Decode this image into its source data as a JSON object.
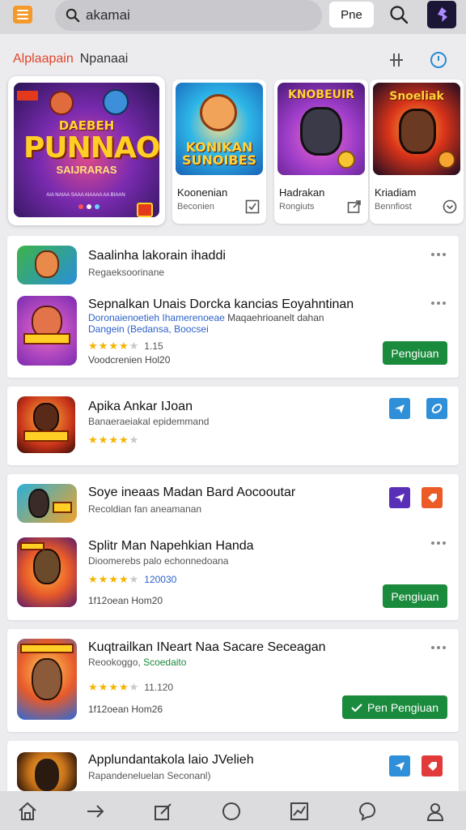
{
  "topbar": {
    "search_text": "akamai",
    "pne_label": "Pne",
    "menu_icon": "hamburger-menu-icon",
    "search_icon": "search-icon",
    "app_icon": "app-logo-icon"
  },
  "section": {
    "title_a": "Alplaapain",
    "title_b": "Npanaai"
  },
  "featured": {
    "main": {
      "line1": "DAEBEH",
      "line2": "PUNNAOK",
      "line3": "SAIJRARAS",
      "fine_print": "AIA NAIAA SAAA AIAAAA AA BIAAN"
    },
    "cards": [
      {
        "art_title": "KONIKAN SUNOIBES",
        "name": "Koonenian",
        "sub": "Beconien",
        "action_icon": "checkbox-icon"
      },
      {
        "art_title": "KNOBEUIR",
        "name": "Hadrakan",
        "sub": "Rongiuts",
        "action_icon": "share-box-icon"
      },
      {
        "art_title": "Snoeliak",
        "name": "Kriadiam",
        "sub": "Bennfiost",
        "action_icon": "chevron-circle-icon"
      }
    ]
  },
  "list": {
    "card1": {
      "row1": {
        "title": "Saalinha lakorain ihaddi",
        "sub": "Regaeksoorinane"
      },
      "row2": {
        "title": "Sepnalkan Unais Dorcka kancias Eoyahntinan",
        "sub_blue": "Doronaienoetieh Ihamerenoeae",
        "sub_gray": "Maqaehrioanelt dahan",
        "sub_blue2": "Dangein (Bedansa, Boocsei",
        "rating_value": 3.5,
        "rating_text": "1.15",
        "meta": "Voodcrenien Hol20",
        "button": "Pengiuan"
      }
    },
    "card2": {
      "row1": {
        "title": "Apika Ankar IJoan",
        "sub": "Banaeraeiakal epidemmand",
        "rating_value": 3.5
      }
    },
    "card3": {
      "row1": {
        "title": "Soye ineaas Madan Bard Aocooutar",
        "sub": "Recoldian fan aneamanan"
      },
      "row2": {
        "title": "Splitr Man Napehkian Handa",
        "sub": "Dioomerebs palo echonnedoana",
        "rating_value": 3.5,
        "rating_text": "120030",
        "meta": "1f12oean Hom20",
        "button": "Pengiuan"
      }
    },
    "card4": {
      "row1": {
        "title": "Kuqtrailkan INeart Naa Sacare Seceagan",
        "sub_gray": "Reookoggo,",
        "sub_green": "Scoedaito",
        "rating_value": 3.5,
        "rating_text": "11.120",
        "meta": "1f12oean Hom26",
        "button": "Pen Pengiuan"
      }
    },
    "card5": {
      "row1": {
        "title": "Applundantakola laio JVelieh",
        "sub": "Rapandeneluelan Seconanl)"
      }
    }
  },
  "colors": {
    "accent_orange": "#f39a2a",
    "title_red": "#e0452a",
    "install_green": "#1a8a3c",
    "action_blue": "#2f8fd8",
    "action_purple": "#5a2fb8",
    "action_orange": "#ec5a26",
    "action_red": "#e23a3a",
    "star_yellow": "#f4b400"
  },
  "bottom_nav": [
    {
      "icon": "home-icon"
    },
    {
      "icon": "arrow-right-icon"
    },
    {
      "icon": "edit-icon"
    },
    {
      "icon": "circle-icon"
    },
    {
      "icon": "chart-box-icon"
    },
    {
      "icon": "chat-icon"
    },
    {
      "icon": "profile-icon"
    }
  ]
}
